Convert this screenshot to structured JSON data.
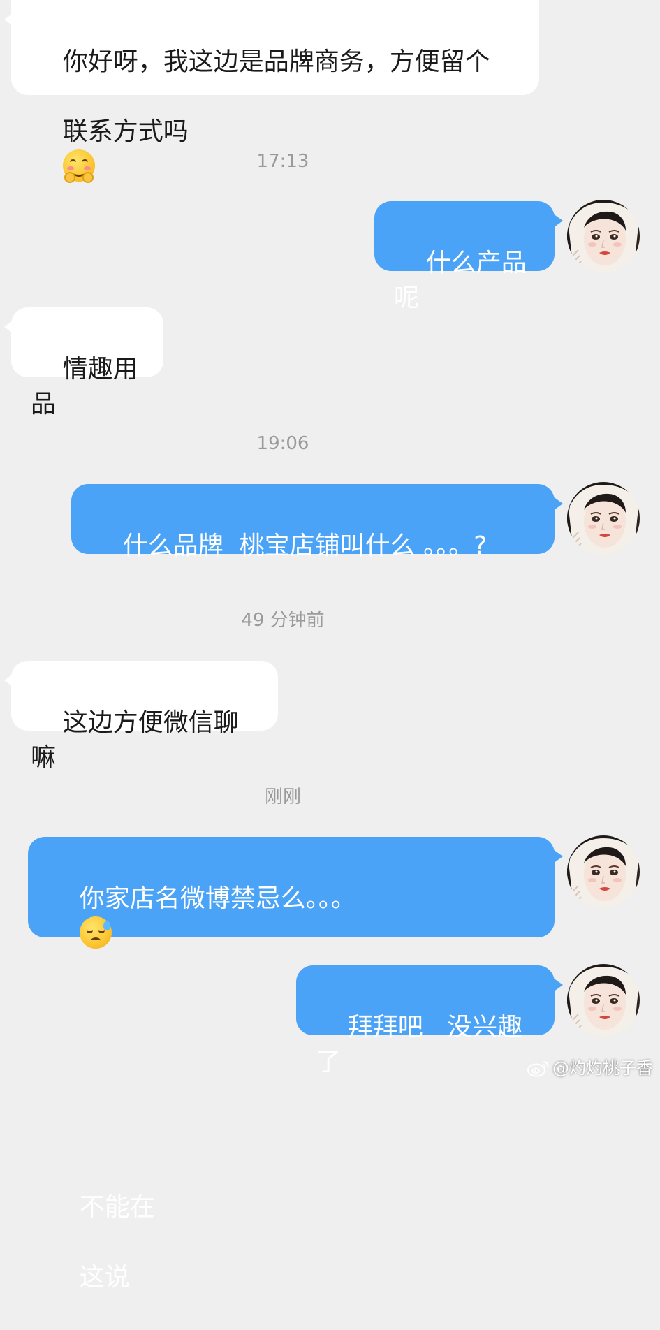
{
  "messages": [
    {
      "direction": "in",
      "text": "你好呀，我这边是品牌商务，方便留个",
      "text2": "联系方式吗",
      "emoji": "hugging-face"
    },
    {
      "timestamp": "17:13"
    },
    {
      "direction": "out",
      "text": "什么产品呢"
    },
    {
      "direction": "in",
      "text": "情趣用品"
    },
    {
      "timestamp": "19:06"
    },
    {
      "direction": "out",
      "text": "什么品牌  桃宝店铺叫什么 。。。?"
    },
    {
      "timestamp": "49 分钟前"
    },
    {
      "direction": "in",
      "text": "这边方便微信聊嘛"
    },
    {
      "timestamp": "刚刚"
    },
    {
      "direction": "out",
      "text": "你家店名微博禁忌么。。。",
      "emoji": "downcast-sweat-face",
      "text_after": "不能在",
      "text2": "这说"
    },
    {
      "direction": "out",
      "text": "拜拜吧   没兴趣了"
    }
  ],
  "watermark": "@灼灼桃子香",
  "colors": {
    "background": "#efefef",
    "incoming_bubble": "#ffffff",
    "outgoing_bubble": "#4aa3f7",
    "timestamp_text": "#9a9a9a"
  }
}
